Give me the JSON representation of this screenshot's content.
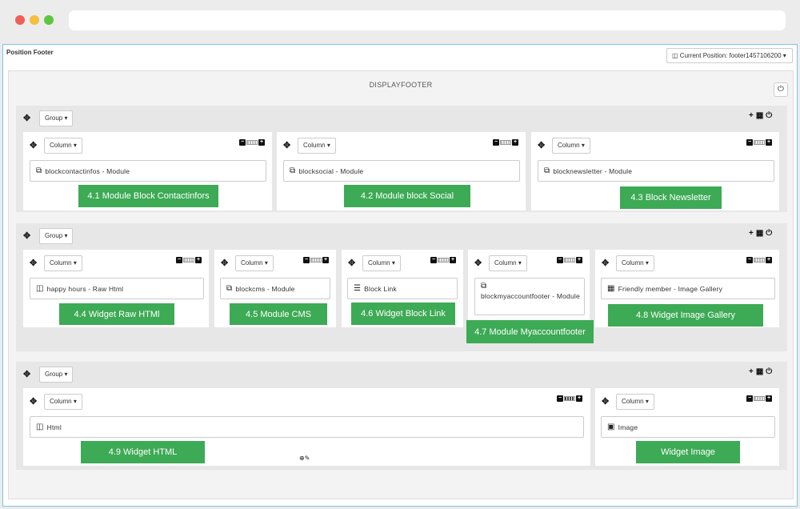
{
  "page": {
    "title": "Position Footer",
    "current_position": "Current Position: footer1457106200",
    "hook_title": "DISPLAYFOOTER",
    "group_label": "Group",
    "column_label": "Column"
  },
  "groups": [
    {
      "columns": [
        {
          "module_text": "blockcontactinfos - Module",
          "icon": "copy-icon",
          "label": "4.1 Module Block Contactinfors"
        },
        {
          "module_text": "blocksocial - Module",
          "icon": "copy-icon",
          "label": "4.2 Module block Social"
        },
        {
          "module_text": "blocknewsletter - Module",
          "icon": "copy-icon",
          "label": "4.3 Block Newsletter"
        }
      ]
    },
    {
      "columns": [
        {
          "module_text": "happy hours - Raw Html",
          "icon": "html5-icon",
          "label": "4.4 Widget Raw HTMl"
        },
        {
          "module_text": "blockcms - Module",
          "icon": "copy-icon",
          "label": "4.5 Module CMS"
        },
        {
          "module_text": "Block Link",
          "icon": "list-icon",
          "label": "4.6 Widget Block Link"
        },
        {
          "module_text": "blockmyaccountfooter - Module",
          "icon": "copy-icon",
          "label": "4.7 Module Myaccountfooter"
        },
        {
          "module_text": "Friendly member - Image Gallery",
          "icon": "grid-icon",
          "label": "4.8 Widget Image Gallery"
        }
      ]
    },
    {
      "columns": [
        {
          "module_text": "Html",
          "icon": "html5-icon",
          "label": "4.9 Widget HTML"
        },
        {
          "module_text": "Image",
          "icon": "image-icon",
          "label": "Widget Image"
        }
      ]
    }
  ]
}
